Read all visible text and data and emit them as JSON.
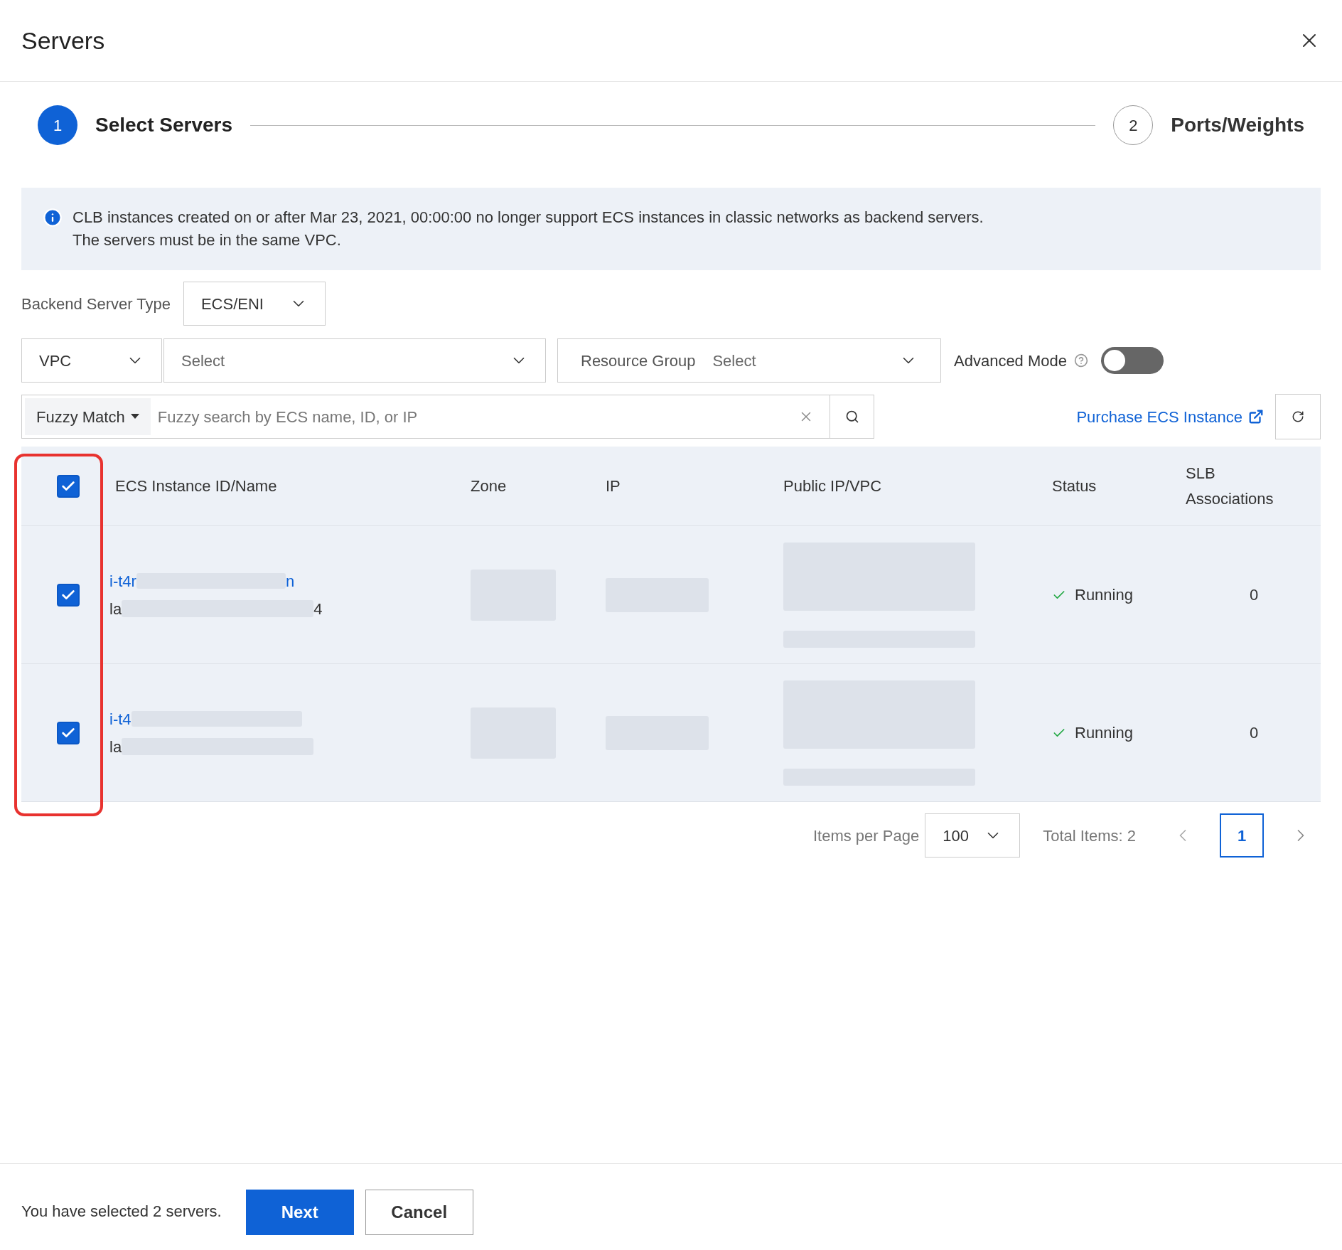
{
  "dialog": {
    "title": "Servers"
  },
  "steps": [
    {
      "number": "1",
      "label": "Select Servers",
      "selected": true
    },
    {
      "number": "2",
      "label": "Ports/Weights",
      "selected": false
    }
  ],
  "notice": {
    "lines": [
      "CLB instances created on or after Mar 23, 2021, 00:00:00 no longer support ECS instances in classic networks as backend servers.",
      "The servers must be in the same VPC."
    ]
  },
  "backend_type": {
    "label": "Backend Server Type",
    "value": "ECS/ENI"
  },
  "filters": {
    "network": "VPC",
    "vpc_placeholder": "Select",
    "resource_group_label": "Resource Group",
    "resource_group_placeholder": "Select",
    "advanced_mode": {
      "label": "Advanced Mode",
      "on": false
    }
  },
  "search": {
    "mode": "Fuzzy Match",
    "placeholder": "Fuzzy search by ECS name, ID, or IP"
  },
  "purchase_link": "Purchase ECS Instance",
  "table": {
    "all_checked": true,
    "columns": [
      "ECS Instance ID/Name",
      "Zone",
      "IP",
      "Public IP/VPC",
      "Status",
      "SLB Associations"
    ],
    "rows": [
      {
        "checked": true,
        "id_start": "i-t4r",
        "id_end": "n",
        "name_start": "la",
        "name_end": "4",
        "status": "Running",
        "slb": "0"
      },
      {
        "checked": true,
        "id_start": "i-t4",
        "id_end": "",
        "name_start": "la",
        "name_end": "",
        "status": "Running",
        "slb": "0"
      }
    ]
  },
  "pagination": {
    "per_page_label": "Items per Page",
    "per_page": "100",
    "total": "Total Items: 2",
    "pages": [
      {
        "label": "1",
        "selected": true
      }
    ]
  },
  "footer": {
    "summary": "You have selected 2 servers.",
    "buttons": [
      {
        "label": "Next",
        "kind": "primary"
      },
      {
        "label": "Cancel",
        "kind": "secondary"
      }
    ]
  }
}
